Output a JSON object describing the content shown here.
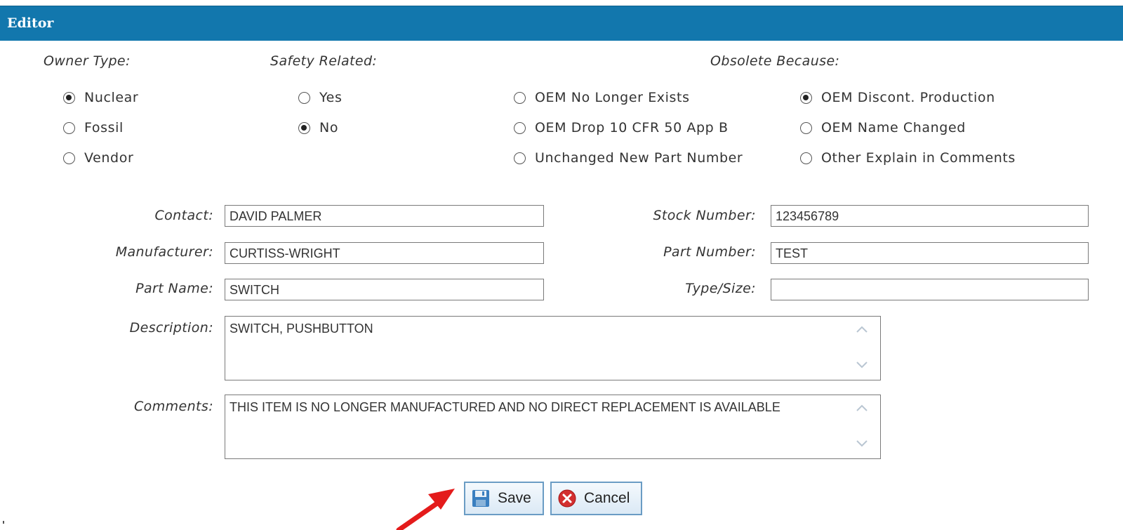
{
  "editor": {
    "title": "Editor"
  },
  "owner_type": {
    "label": "Owner Type:",
    "options": [
      {
        "label": "Nuclear",
        "checked": true
      },
      {
        "label": "Fossil",
        "checked": false
      },
      {
        "label": "Vendor",
        "checked": false
      }
    ]
  },
  "safety_related": {
    "label": "Safety Related:",
    "options": [
      {
        "label": "Yes",
        "checked": false
      },
      {
        "label": "No",
        "checked": true
      }
    ]
  },
  "obsolete_because": {
    "label": "Obsolete Because:",
    "options": [
      {
        "label": "OEM No Longer Exists",
        "checked": false
      },
      {
        "label": "OEM Discont. Production",
        "checked": true
      },
      {
        "label": "OEM Drop 10 CFR 50 App B",
        "checked": false
      },
      {
        "label": "OEM Name Changed",
        "checked": false
      },
      {
        "label": "Unchanged New Part Number",
        "checked": false
      },
      {
        "label": "Other Explain in Comments",
        "checked": false
      }
    ]
  },
  "fields": {
    "contact": {
      "label": "Contact:",
      "value": "DAVID PALMER"
    },
    "manufacturer": {
      "label": "Manufacturer:",
      "value": "CURTISS-WRIGHT"
    },
    "part_name": {
      "label": "Part Name:",
      "value": "SWITCH"
    },
    "stock_number": {
      "label": "Stock Number:",
      "value": "123456789"
    },
    "part_number": {
      "label": "Part Number:",
      "value": "TEST"
    },
    "type_size": {
      "label": "Type/Size:",
      "value": ""
    },
    "description": {
      "label": "Description:",
      "value": "SWITCH, PUSHBUTTON"
    },
    "comments": {
      "label": "Comments:",
      "value": "THIS ITEM IS NO LONGER MANUFACTURED AND NO DIRECT REPLACEMENT IS AVAILABLE"
    }
  },
  "buttons": {
    "save": {
      "label": "Save",
      "icon": "floppy-disk-icon"
    },
    "cancel": {
      "label": "Cancel",
      "icon": "cancel-circle-icon"
    }
  },
  "colors": {
    "titlebar": "#1277ad",
    "button_border": "#6a9cc4",
    "arrow": "#e41b1b",
    "cancel_icon": "#d32f2f"
  }
}
